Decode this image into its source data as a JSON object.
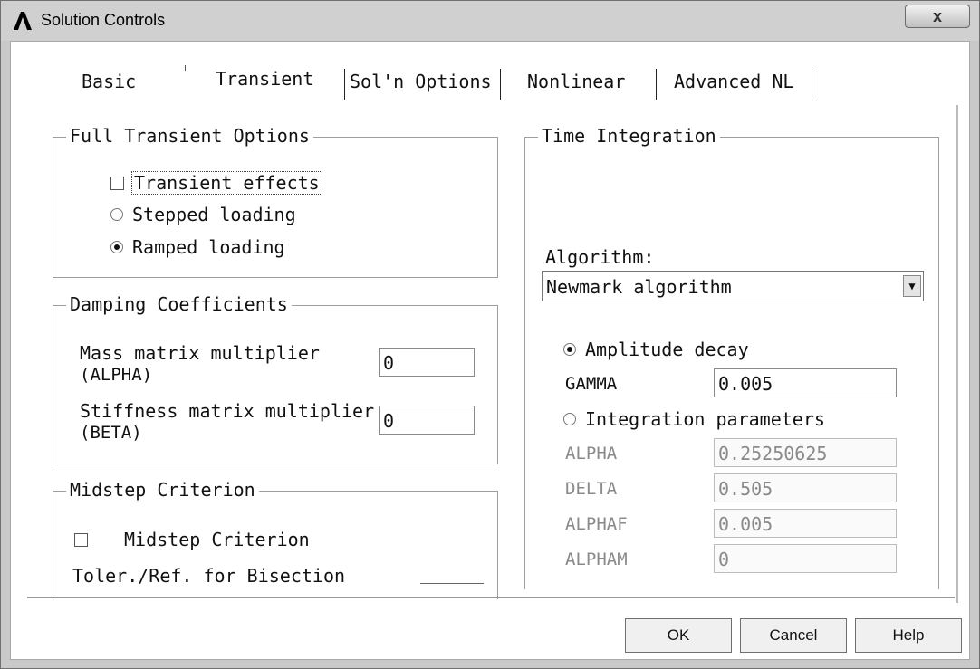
{
  "window": {
    "title": "Solution Controls",
    "close_label": "x"
  },
  "tabs": [
    {
      "label": "Basic",
      "selected": false
    },
    {
      "label": "Transient",
      "selected": true
    },
    {
      "label": "Sol'n Options",
      "selected": false
    },
    {
      "label": "Nonlinear",
      "selected": false
    },
    {
      "label": "Advanced NL",
      "selected": false
    }
  ],
  "full_transient": {
    "title": "Full Transient Options",
    "transient_effects": {
      "label": "Transient effects",
      "checked": false
    },
    "stepped_loading": {
      "label": "Stepped loading",
      "selected": false
    },
    "ramped_loading": {
      "label": "Ramped loading",
      "selected": true
    }
  },
  "damping": {
    "title": "Damping Coefficients",
    "mass_label_1": "Mass matrix multiplier",
    "mass_label_2": "(ALPHA)",
    "mass_value": "0",
    "stiffness_label_1": "Stiffness matrix multiplier",
    "stiffness_label_2": "(BETA)",
    "stiffness_value": "0"
  },
  "midstep": {
    "title": "Midstep Criterion",
    "checkbox_label": "Midstep Criterion",
    "checked": false,
    "toler_label": "Toler./Ref. for Bisection"
  },
  "time_integration": {
    "title": "Time Integration",
    "algorithm_label": "Algorithm:",
    "algorithm_value": "Newmark algorithm",
    "amplitude_decay": {
      "label": "Amplitude decay",
      "selected": true
    },
    "gamma_label": "GAMMA",
    "gamma_value": "0.005",
    "integration_parameters": {
      "label": "Integration parameters",
      "selected": false
    },
    "alpha_label": "ALPHA",
    "alpha_value": "0.25250625",
    "delta_label": "DELTA",
    "delta_value": "0.505",
    "alphaf_label": "ALPHAF",
    "alphaf_value": "0.005",
    "alpham_label": "ALPHAM",
    "alpham_value": "0"
  },
  "buttons": {
    "ok": "OK",
    "cancel": "Cancel",
    "help": "Help"
  }
}
